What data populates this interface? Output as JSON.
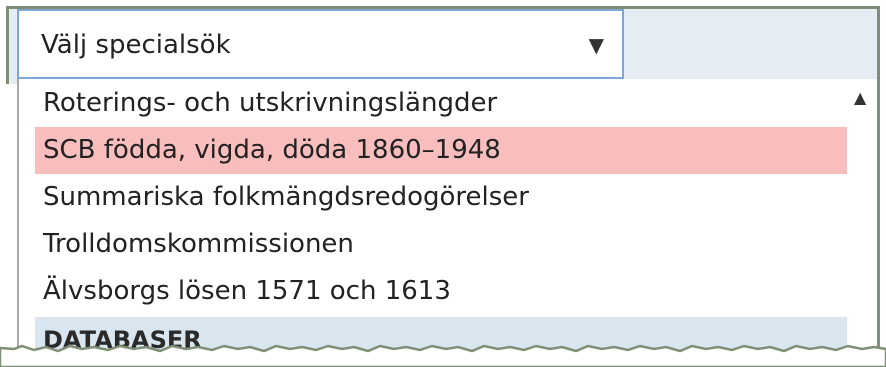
{
  "select": {
    "value": "Välj specialsök",
    "arrow_icon": "dropdown-triangle-icon"
  },
  "dropdown": {
    "options": [
      {
        "label": "Roterings- och utskrivningslängder",
        "highlighted": false
      },
      {
        "label": "SCB födda, vigda, döda 1860–1948",
        "highlighted": true
      },
      {
        "label": "Summariska folkmängdsredogörelser",
        "highlighted": false
      },
      {
        "label": "Trolldomskommissionen",
        "highlighted": false
      },
      {
        "label": "Älvsborgs lösen 1571 och 1613",
        "highlighted": false
      }
    ],
    "group_header": "DATABASER",
    "scroll_up_icon": "scroll-up-arrow-icon"
  },
  "colors": {
    "highlight": "#f8bdbd",
    "group_header_bg": "#d9e6ef",
    "band_bg": "#e5edf4",
    "border_accent": "#7e8f76",
    "select_border": "#7ea6d9"
  }
}
